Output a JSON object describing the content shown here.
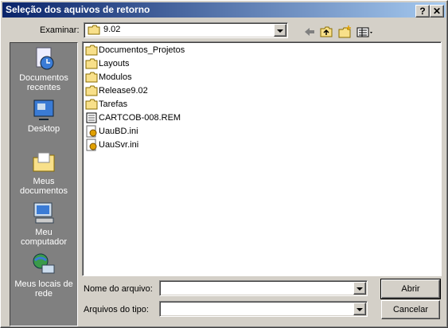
{
  "window": {
    "title": "Seleção dos aquivos de retorno",
    "help_btn": "?",
    "close_btn": "✕"
  },
  "toolbar": {
    "lookin_label": "Examinar:",
    "lookin_value": "9.02"
  },
  "places": [
    {
      "l1": "Documentos",
      "l2": "recentes",
      "icon": "recent-documents-icon"
    },
    {
      "l1": "Desktop",
      "l2": "",
      "icon": "desktop-icon"
    },
    {
      "l1": "Meus",
      "l2": "documentos",
      "icon": "my-documents-icon"
    },
    {
      "l1": "Meu",
      "l2": "computador",
      "icon": "my-computer-icon"
    },
    {
      "l1": "Meus locais de",
      "l2": "rede",
      "icon": "network-places-icon"
    }
  ],
  "files": [
    {
      "name": "Documentos_Projetos",
      "type": "folder"
    },
    {
      "name": "Layouts",
      "type": "folder"
    },
    {
      "name": "Modulos",
      "type": "folder"
    },
    {
      "name": "Release9.02",
      "type": "folder"
    },
    {
      "name": "Tarefas",
      "type": "folder"
    },
    {
      "name": "CARTCOB-008.REM",
      "type": "file"
    },
    {
      "name": "UauBD.ini",
      "type": "ini"
    },
    {
      "name": "UauSvr.ini",
      "type": "ini"
    }
  ],
  "form": {
    "filename_label": "Nome do arquivo:",
    "filename_value": "",
    "filetype_label": "Arquivos do tipo:",
    "filetype_value": ""
  },
  "buttons": {
    "open": "Abrir",
    "cancel": "Cancelar"
  }
}
